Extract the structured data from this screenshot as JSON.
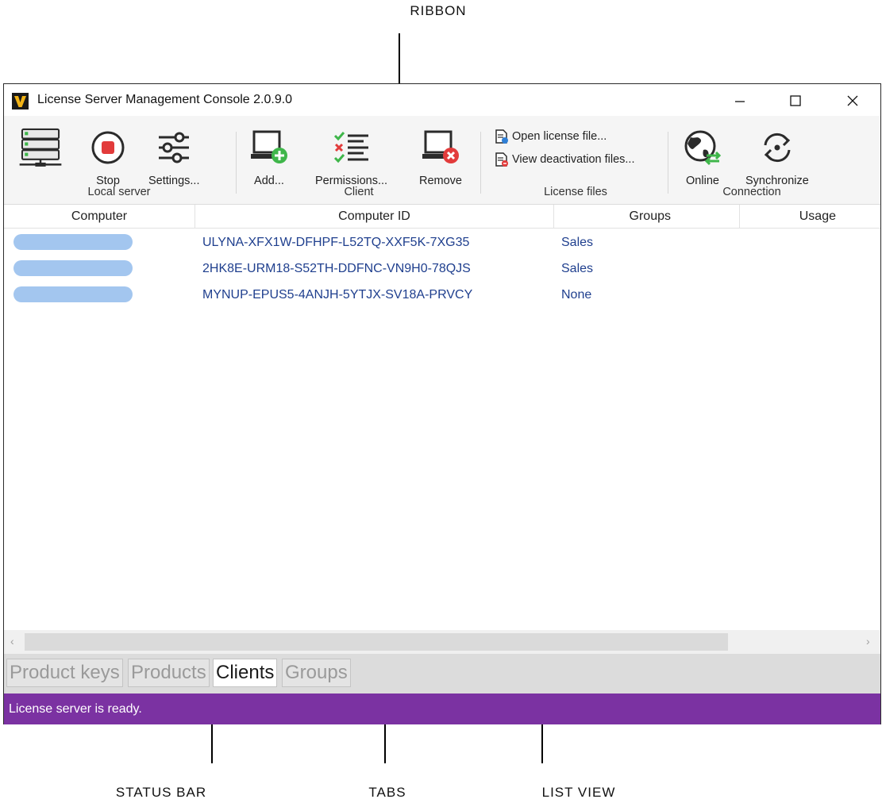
{
  "callouts": {
    "ribbon": "RIBBON",
    "status_bar": "STATUS BAR",
    "tabs": "TABS",
    "list_view": "LIST VIEW"
  },
  "window": {
    "title": "License Server Management Console 2.0.9.0"
  },
  "ribbon": {
    "local_server": {
      "group": "Local server",
      "stop": "Stop",
      "settings": "Settings..."
    },
    "client": {
      "group": "Client",
      "add": "Add...",
      "permissions": "Permissions...",
      "remove": "Remove"
    },
    "license_files": {
      "group": "License files",
      "open": "Open license file...",
      "view_deactivation": "View deactivation files..."
    },
    "connection": {
      "group": "Connection",
      "online": "Online",
      "synchronize": "Synchronize"
    }
  },
  "list": {
    "columns": [
      "Computer",
      "Computer ID",
      "Groups",
      "Usage"
    ],
    "rows": [
      {
        "computer_id": "ULYNA-XFX1W-DFHPF-L52TQ-XXF5K-7XG35",
        "group": "Sales",
        "usage": ""
      },
      {
        "computer_id": "2HK8E-URM18-S52TH-DDFNC-VN9H0-78QJS",
        "group": "Sales",
        "usage": ""
      },
      {
        "computer_id": "MYNUP-EPUS5-4ANJH-5YTJX-SV18A-PRVCY",
        "group": "None",
        "usage": ""
      }
    ]
  },
  "tabs": [
    "Product keys",
    "Products",
    "Clients",
    "Groups"
  ],
  "active_tab": "Clients",
  "status": {
    "text": "License server is ready."
  },
  "colors": {
    "status_bar": "#7b32a2",
    "link_text": "#1f3f8e",
    "redaction": "#a3c6ef"
  }
}
